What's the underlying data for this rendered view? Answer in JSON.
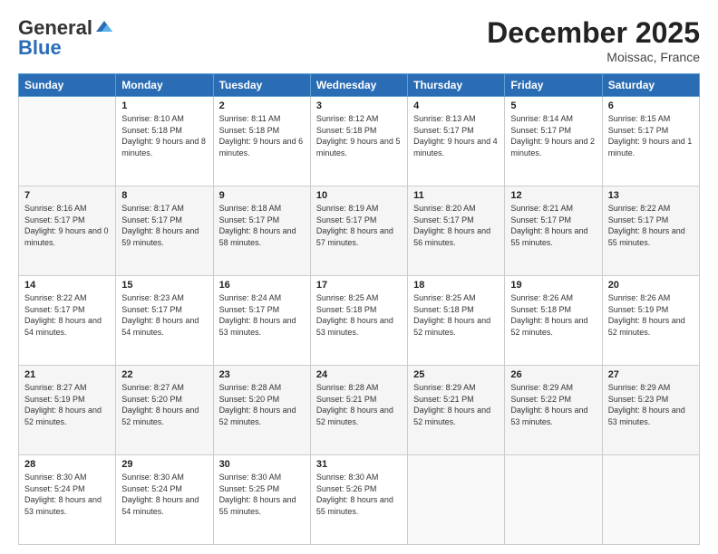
{
  "header": {
    "logo_line1": "General",
    "logo_line2": "Blue",
    "month": "December 2025",
    "location": "Moissac, France"
  },
  "weekdays": [
    "Sunday",
    "Monday",
    "Tuesday",
    "Wednesday",
    "Thursday",
    "Friday",
    "Saturday"
  ],
  "weeks": [
    [
      {
        "day": "",
        "sunrise": "",
        "sunset": "",
        "daylight": ""
      },
      {
        "day": "1",
        "sunrise": "Sunrise: 8:10 AM",
        "sunset": "Sunset: 5:18 PM",
        "daylight": "Daylight: 9 hours and 8 minutes."
      },
      {
        "day": "2",
        "sunrise": "Sunrise: 8:11 AM",
        "sunset": "Sunset: 5:18 PM",
        "daylight": "Daylight: 9 hours and 6 minutes."
      },
      {
        "day": "3",
        "sunrise": "Sunrise: 8:12 AM",
        "sunset": "Sunset: 5:18 PM",
        "daylight": "Daylight: 9 hours and 5 minutes."
      },
      {
        "day": "4",
        "sunrise": "Sunrise: 8:13 AM",
        "sunset": "Sunset: 5:17 PM",
        "daylight": "Daylight: 9 hours and 4 minutes."
      },
      {
        "day": "5",
        "sunrise": "Sunrise: 8:14 AM",
        "sunset": "Sunset: 5:17 PM",
        "daylight": "Daylight: 9 hours and 2 minutes."
      },
      {
        "day": "6",
        "sunrise": "Sunrise: 8:15 AM",
        "sunset": "Sunset: 5:17 PM",
        "daylight": "Daylight: 9 hours and 1 minute."
      }
    ],
    [
      {
        "day": "7",
        "sunrise": "Sunrise: 8:16 AM",
        "sunset": "Sunset: 5:17 PM",
        "daylight": "Daylight: 9 hours and 0 minutes."
      },
      {
        "day": "8",
        "sunrise": "Sunrise: 8:17 AM",
        "sunset": "Sunset: 5:17 PM",
        "daylight": "Daylight: 8 hours and 59 minutes."
      },
      {
        "day": "9",
        "sunrise": "Sunrise: 8:18 AM",
        "sunset": "Sunset: 5:17 PM",
        "daylight": "Daylight: 8 hours and 58 minutes."
      },
      {
        "day": "10",
        "sunrise": "Sunrise: 8:19 AM",
        "sunset": "Sunset: 5:17 PM",
        "daylight": "Daylight: 8 hours and 57 minutes."
      },
      {
        "day": "11",
        "sunrise": "Sunrise: 8:20 AM",
        "sunset": "Sunset: 5:17 PM",
        "daylight": "Daylight: 8 hours and 56 minutes."
      },
      {
        "day": "12",
        "sunrise": "Sunrise: 8:21 AM",
        "sunset": "Sunset: 5:17 PM",
        "daylight": "Daylight: 8 hours and 55 minutes."
      },
      {
        "day": "13",
        "sunrise": "Sunrise: 8:22 AM",
        "sunset": "Sunset: 5:17 PM",
        "daylight": "Daylight: 8 hours and 55 minutes."
      }
    ],
    [
      {
        "day": "14",
        "sunrise": "Sunrise: 8:22 AM",
        "sunset": "Sunset: 5:17 PM",
        "daylight": "Daylight: 8 hours and 54 minutes."
      },
      {
        "day": "15",
        "sunrise": "Sunrise: 8:23 AM",
        "sunset": "Sunset: 5:17 PM",
        "daylight": "Daylight: 8 hours and 54 minutes."
      },
      {
        "day": "16",
        "sunrise": "Sunrise: 8:24 AM",
        "sunset": "Sunset: 5:17 PM",
        "daylight": "Daylight: 8 hours and 53 minutes."
      },
      {
        "day": "17",
        "sunrise": "Sunrise: 8:25 AM",
        "sunset": "Sunset: 5:18 PM",
        "daylight": "Daylight: 8 hours and 53 minutes."
      },
      {
        "day": "18",
        "sunrise": "Sunrise: 8:25 AM",
        "sunset": "Sunset: 5:18 PM",
        "daylight": "Daylight: 8 hours and 52 minutes."
      },
      {
        "day": "19",
        "sunrise": "Sunrise: 8:26 AM",
        "sunset": "Sunset: 5:18 PM",
        "daylight": "Daylight: 8 hours and 52 minutes."
      },
      {
        "day": "20",
        "sunrise": "Sunrise: 8:26 AM",
        "sunset": "Sunset: 5:19 PM",
        "daylight": "Daylight: 8 hours and 52 minutes."
      }
    ],
    [
      {
        "day": "21",
        "sunrise": "Sunrise: 8:27 AM",
        "sunset": "Sunset: 5:19 PM",
        "daylight": "Daylight: 8 hours and 52 minutes."
      },
      {
        "day": "22",
        "sunrise": "Sunrise: 8:27 AM",
        "sunset": "Sunset: 5:20 PM",
        "daylight": "Daylight: 8 hours and 52 minutes."
      },
      {
        "day": "23",
        "sunrise": "Sunrise: 8:28 AM",
        "sunset": "Sunset: 5:20 PM",
        "daylight": "Daylight: 8 hours and 52 minutes."
      },
      {
        "day": "24",
        "sunrise": "Sunrise: 8:28 AM",
        "sunset": "Sunset: 5:21 PM",
        "daylight": "Daylight: 8 hours and 52 minutes."
      },
      {
        "day": "25",
        "sunrise": "Sunrise: 8:29 AM",
        "sunset": "Sunset: 5:21 PM",
        "daylight": "Daylight: 8 hours and 52 minutes."
      },
      {
        "day": "26",
        "sunrise": "Sunrise: 8:29 AM",
        "sunset": "Sunset: 5:22 PM",
        "daylight": "Daylight: 8 hours and 53 minutes."
      },
      {
        "day": "27",
        "sunrise": "Sunrise: 8:29 AM",
        "sunset": "Sunset: 5:23 PM",
        "daylight": "Daylight: 8 hours and 53 minutes."
      }
    ],
    [
      {
        "day": "28",
        "sunrise": "Sunrise: 8:30 AM",
        "sunset": "Sunset: 5:24 PM",
        "daylight": "Daylight: 8 hours and 53 minutes."
      },
      {
        "day": "29",
        "sunrise": "Sunrise: 8:30 AM",
        "sunset": "Sunset: 5:24 PM",
        "daylight": "Daylight: 8 hours and 54 minutes."
      },
      {
        "day": "30",
        "sunrise": "Sunrise: 8:30 AM",
        "sunset": "Sunset: 5:25 PM",
        "daylight": "Daylight: 8 hours and 55 minutes."
      },
      {
        "day": "31",
        "sunrise": "Sunrise: 8:30 AM",
        "sunset": "Sunset: 5:26 PM",
        "daylight": "Daylight: 8 hours and 55 minutes."
      },
      {
        "day": "",
        "sunrise": "",
        "sunset": "",
        "daylight": ""
      },
      {
        "day": "",
        "sunrise": "",
        "sunset": "",
        "daylight": ""
      },
      {
        "day": "",
        "sunrise": "",
        "sunset": "",
        "daylight": ""
      }
    ]
  ]
}
